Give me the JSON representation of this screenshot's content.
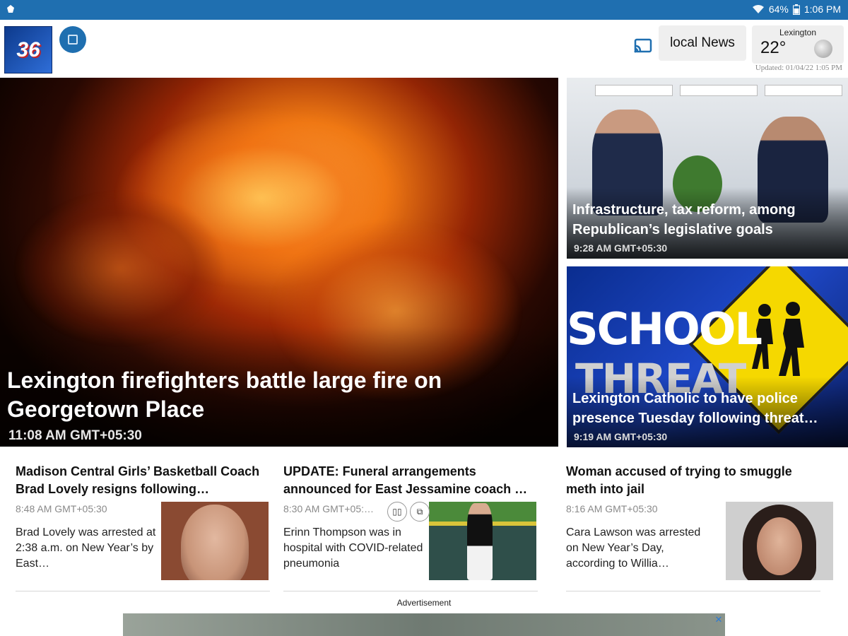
{
  "status_bar": {
    "battery": "64%",
    "time": "1:06 PM"
  },
  "header": {
    "logo_number": "36",
    "local_news_label": "local News",
    "weather": {
      "city": "Lexington",
      "temperature": "22°"
    },
    "updated": "Updated: 01/04/22 1:05 PM"
  },
  "hero": {
    "title": "Lexington firefighters battle large fire on Georgetown Place",
    "time": "11:08 AM GMT+05:30"
  },
  "side_cards": [
    {
      "title": "Infrastructure, tax reform, among Republican’s legislative goals",
      "time": "9:28 AM GMT+05:30"
    },
    {
      "title": "Lexington Catholic to have police presence Tuesday following threat…",
      "time": "9:19 AM GMT+05:30",
      "image_text_1": "SCHOOL",
      "image_text_2": "THREAT"
    }
  ],
  "articles": [
    {
      "title": "Madison Central Girls’ Basketball Coach Brad Lovely resigns following…",
      "time": "8:48 AM GMT+05:30",
      "description": "Brad Lovely was arrested at 2:38 a.m. on New Year’s by East…"
    },
    {
      "title": "UPDATE: Funeral arrangements announced for East Jessamine coach …",
      "time": "8:30 AM GMT+05:…",
      "description": "Erinn Thompson was in hospital with COVID-related pneumonia"
    },
    {
      "title": "Woman accused of trying to smuggle meth into jail",
      "time": "8:16 AM GMT+05:30",
      "description": "Cara Lawson was arrested on New Year’s Day, according to Willia…"
    }
  ],
  "ad": {
    "label": "Advertisement"
  },
  "colors": {
    "status_bar": "#1f6fb0",
    "accent": "#1f6fb0"
  }
}
